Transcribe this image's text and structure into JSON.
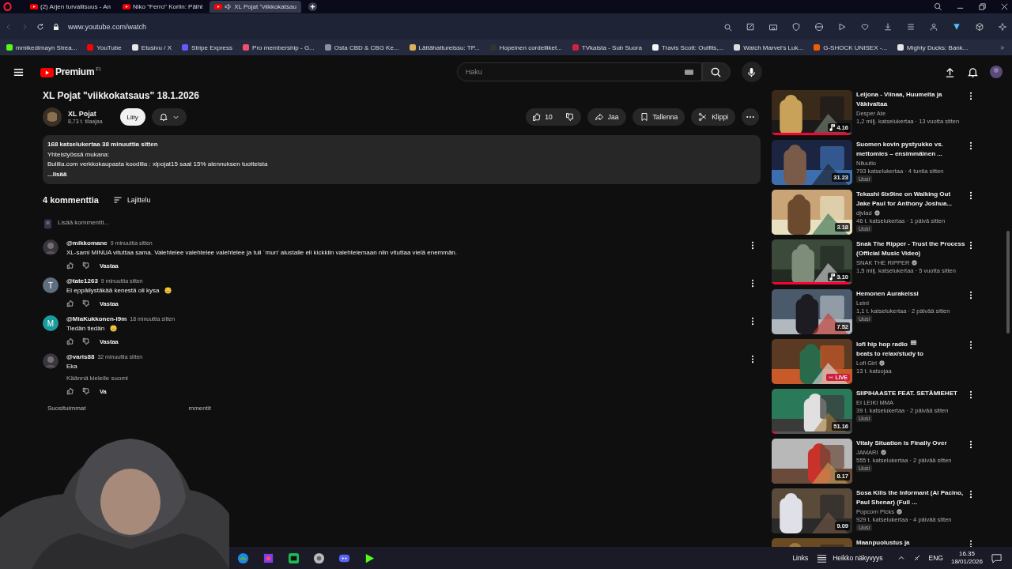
{
  "browser": {
    "tabs": [
      {
        "title": "(2) Arjen turvallisuus - An",
        "selected": false,
        "audio": false
      },
      {
        "title": "Niko \"Ferro\" Korlin: Päiht",
        "selected": false,
        "audio": false
      },
      {
        "title": "XL Pojat \"viikkokatsau",
        "selected": true,
        "audio": true
      }
    ],
    "url": "www.youtube.com/watch",
    "bookmarks": [
      {
        "label": "mmikedimayn Strea...",
        "color": "#53fc18"
      },
      {
        "label": "YouTube",
        "color": "#ff0000"
      },
      {
        "label": "Etusivu / X",
        "color": "#e8e8e8"
      },
      {
        "label": "Stripe Express",
        "color": "#635bff"
      },
      {
        "label": "Pro membership - G...",
        "color": "#f0506e"
      },
      {
        "label": "Osta CBD & CBG Ke...",
        "color": "#8a8f9c"
      },
      {
        "label": "Lättähattureissu: TP...",
        "color": "#d9b25a"
      },
      {
        "label": "Hopeinen cordelliket...",
        "color": "#333333"
      },
      {
        "label": "TVkaista - Sub Suora",
        "color": "#d4213d"
      },
      {
        "label": "Travis Scott: Outfits,...",
        "color": "#f5f5f5"
      },
      {
        "label": "Watch Marvel's Luk...",
        "color": "#dddddd"
      },
      {
        "label": "G-SHOCK UNISEX -...",
        "color": "#f25c05"
      },
      {
        "label": "Mighty Ducks: Bank...",
        "color": "#e6e6e6"
      }
    ]
  },
  "header": {
    "logo": "Premium",
    "region": "FI",
    "search": {
      "placeholder": "Haku"
    }
  },
  "video": {
    "title": "XL Pojat \"viikkokatsaus\" 18.1.2026",
    "channel": "XL Pojat",
    "subscribers": "8,73 t. tilaajaa",
    "join": "Liity",
    "likes": "10",
    "share": "Jaa",
    "save": "Tallenna",
    "clip": "Klippi",
    "description": {
      "stats": "168 katselukertaa  38 minuuttia sitten",
      "lines": [
        "Yhteistyössä mukana:",
        "Bulilla.com verkkokaupasta koodilla : xlpojat15 saat 15% alennuksen tuotteista"
      ],
      "more": "...lisää"
    }
  },
  "comments": {
    "count": "4 kommenttia",
    "sort": "Lajittelu",
    "placeholder": "Lisää kommentti...",
    "items": [
      {
        "author": "@mikkomane",
        "time": "9 minuuttia sitten",
        "text": "XL-sami MINUA vituttaa sama. Valehtelee valehtelee valehtelee ja tuli ´mun’ alustalle eli kickkiin valehtelemaan niin vituttaa vielä enemmän.",
        "emoji": false,
        "reply": "Vastaa"
      },
      {
        "author": "@tate1263",
        "time": "9 minuuttia sitten",
        "text": "Ei eppäilystäkää kenestä oli kysa",
        "emoji": true,
        "avatar": {
          "kind": "letter",
          "letter": "T",
          "color": "#5f6f80"
        },
        "reply": "Vastaa"
      },
      {
        "author": "@MiaKukkonen-i9m",
        "time": "18 minuuttia sitten",
        "text": "Tiedän tiedän",
        "emoji": true,
        "avatar": {
          "kind": "letter",
          "letter": "M",
          "color": "#1a9c9c"
        },
        "reply": "Vastaa"
      },
      {
        "author": "@varis88",
        "time": "32 minuuttia sitten",
        "text": "Eka",
        "emoji": false,
        "translate": "Käännä kielelle suomi",
        "reply": "Va"
      }
    ],
    "footer": [
      "Suosituimmat",
      "mmentit"
    ]
  },
  "sidebar": [
    {
      "title": "Leijona - Viinaa, Huumeita ja Väkivaltaa",
      "channel": "Desper Ate",
      "verified": false,
      "meta": "1,2 milj. katselukertaa · 13 vuotta sitten",
      "duration": "4.16",
      "music": true,
      "level": 0.96
    },
    {
      "title": "Suomen kovin pystyukko vs. mettomies – ensimmäinen ...",
      "channel": "Niluutio",
      "verified": false,
      "meta": "793 katselukertaa · 4 tuntia sitten",
      "badge": "Uusi",
      "duration": "31.23"
    },
    {
      "title": "Tekashi 6ix9ine on Walking Out Jake Paul for Anthony Joshua...",
      "channel": "djvlad",
      "verified": true,
      "meta": "46 t. katselukertaa · 1 päivä sitten",
      "badge": "Uusi",
      "duration": "3.18"
    },
    {
      "title": "Snak The Ripper - Trust the Process (Official Music Video)",
      "channel": "SNAK THE RIPPER",
      "verified": true,
      "meta": "1,5 milj. katselukertaa · 5 vuotta sitten",
      "duration": "3.10",
      "music": true,
      "level": 0.96
    },
    {
      "title": "Hemonen Aurakeissi",
      "channel": "Leini",
      "verified": false,
      "meta": "1,1 t. katselukertaa · 2 päivää sitten",
      "badge": "Uusi",
      "duration": "7.52"
    },
    {
      "title": "lofi hip hop radio",
      "title_after": "beats to relax/study to",
      "channel": "Lofi Girl",
      "verified": true,
      "meta": "13 t. katsojaa",
      "live": "LIVE"
    },
    {
      "title": "SIIPIHAASTE FEAT. SETÄMIEHET",
      "channel": "EI LEIKI MMA",
      "verified": false,
      "meta": "39 t. katselukertaa · 2 päivää sitten",
      "badge": "Uusi",
      "duration": "51.16",
      "level": 0.05
    },
    {
      "title": "Vitaly Situation is Finally Over",
      "channel": "JAMARI",
      "verified": true,
      "meta": "555 t. katselukertaa · 2 päivää sitten",
      "badge": "Uusi",
      "duration": "8.17"
    },
    {
      "title": "Sosa Kills the Informant (Al Pacino, Paul Shenar) (Full ...",
      "channel": "Popcorn Picks",
      "verified": true,
      "meta": "929 t. katselukertaa · 4 päivää sitten",
      "badge": "Uusi",
      "duration": "9.09"
    },
    {
      "title": "Maanpuolustus ja"
    }
  ],
  "taskbar": {
    "links": "Links",
    "weather": "Heikko näkyvyys",
    "language": "ENG",
    "time": "16.35",
    "date": "18/01/2026"
  }
}
